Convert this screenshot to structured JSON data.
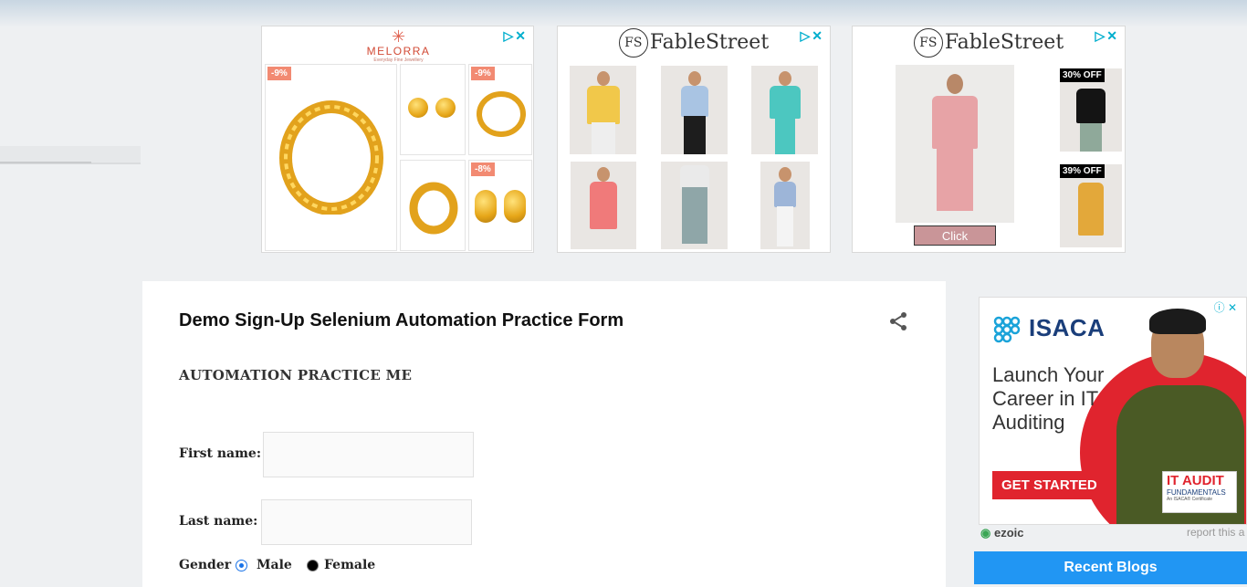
{
  "ads": {
    "adchoices_label": "▷✕",
    "melorra": {
      "brand": "MELORRA",
      "tagline": "Everyday Fine Jewellery",
      "discounts": [
        "-9%",
        "-9%",
        "-8%"
      ]
    },
    "fablestreet_1": {
      "brand": "FableStreet",
      "monogram": "FS"
    },
    "fablestreet_2": {
      "brand": "FableStreet",
      "monogram": "FS",
      "offers": [
        "30% OFF",
        "39% OFF"
      ],
      "cta": "Click"
    },
    "isaca": {
      "brand": "ISACA",
      "headline_1": "Launch Your",
      "headline_2": "Career in IT",
      "headline_3": "Auditing",
      "cta": "GET STARTED",
      "badge_title": "IT AUDIT",
      "badge_sub": "FUNDAMENTALS",
      "badge_note": "An ISACA® Certificate",
      "info": "ⓘ ✕"
    },
    "ezoic_label": "ezoic",
    "report_label": "report this a"
  },
  "post": {
    "title": "Demo Sign-Up Selenium Automation Practice Form",
    "subheading": "AUTOMATION PRACTICE ME"
  },
  "form": {
    "first_name_label": "First name:",
    "first_name_value": "",
    "last_name_label": "Last name:",
    "last_name_value": "",
    "gender_label": "Gender",
    "gender_options": [
      "Male",
      "Female"
    ],
    "gender_selected": "Male"
  },
  "sidebar": {
    "recent_blogs_label": "Recent Blogs"
  },
  "colors": {
    "accent": "#2196f3",
    "isaca_red": "#e0242e",
    "melorra_red": "#d24a35",
    "radio_blue": "#1a73e8"
  }
}
